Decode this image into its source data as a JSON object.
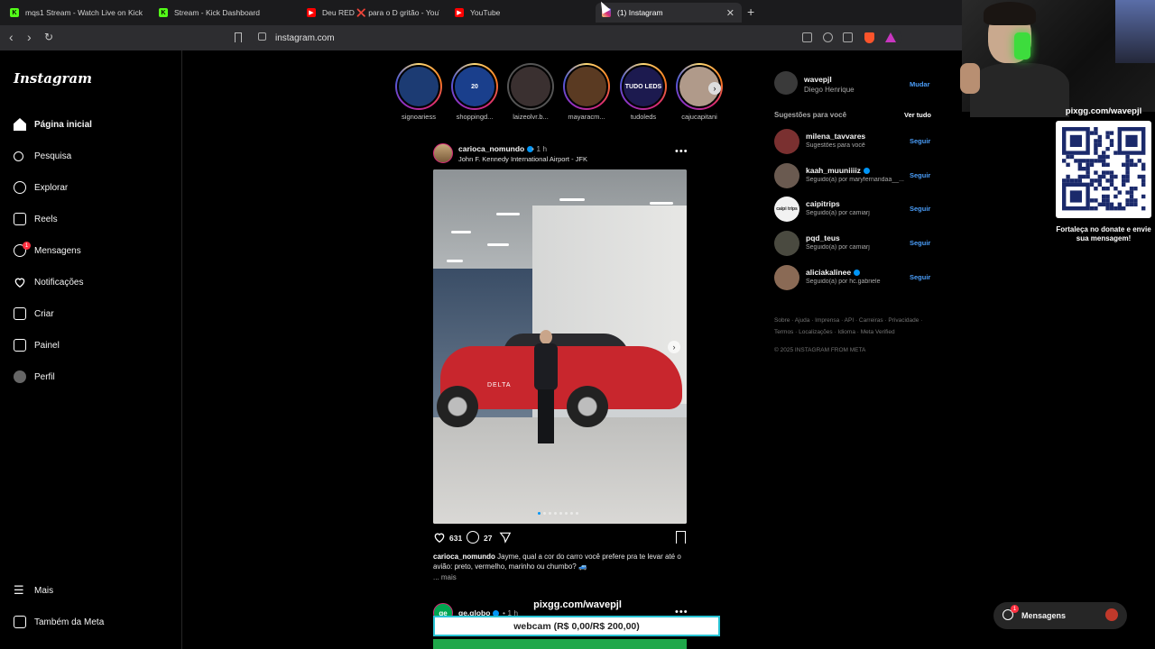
{
  "browser": {
    "tabs": [
      {
        "title": "mqs1 Stream - Watch Live on Kick",
        "icon": "kick-icon",
        "active": false
      },
      {
        "title": "Stream - Kick Dashboard",
        "icon": "kick-icon",
        "active": false
      },
      {
        "title": "Deu RED ❌ para o D gritão - YouTube",
        "icon": "youtube-icon",
        "active": false
      },
      {
        "title": "YouTube",
        "icon": "youtube-icon",
        "active": false
      },
      {
        "title": "(1) Instagram",
        "icon": "instagram-icon",
        "active": true
      }
    ],
    "url": "instagram.com"
  },
  "instagram": {
    "logo": "Instagram",
    "nav": [
      {
        "label": "Página inicial",
        "icon": "home-icon"
      },
      {
        "label": "Pesquisa",
        "icon": "search-icon"
      },
      {
        "label": "Explorar",
        "icon": "compass-icon"
      },
      {
        "label": "Reels",
        "icon": "reels-icon"
      },
      {
        "label": "Mensagens",
        "icon": "messenger-icon",
        "badge": "1"
      },
      {
        "label": "Notificações",
        "icon": "heart-icon"
      },
      {
        "label": "Criar",
        "icon": "plus-square-icon"
      },
      {
        "label": "Painel",
        "icon": "dashboard-icon"
      },
      {
        "label": "Perfil",
        "icon": "profile-avatar"
      },
      {
        "label": "Mais",
        "icon": "menu-icon"
      },
      {
        "label": "Também da Meta",
        "icon": "meta-icon"
      }
    ],
    "stories": [
      {
        "name": "signoariess",
        "color": "#1c3b73",
        "text": ""
      },
      {
        "name": "shoppingd...",
        "color": "#1a3f8c",
        "text": "20"
      },
      {
        "name": "laizeolvr.b...",
        "color": "#3a3030",
        "text": ""
      },
      {
        "name": "mayaracm...",
        "color": "#5a3a22",
        "text": ""
      },
      {
        "name": "tudoleds",
        "color": "#1c1a4f",
        "text": "TUDO LEDS"
      },
      {
        "name": "cajucapitani",
        "color": "#b09a8a",
        "text": ""
      }
    ],
    "post": {
      "user": "carioca_nomundo",
      "time": "• 1 h",
      "location": "John F. Kennedy International Airport - JFK",
      "likes": "631",
      "comments": "27",
      "caption_user": "carioca_nomundo",
      "caption": "Jayme, qual a cor do carro você prefere pra te levar até o avião: preto, vermelho, marinho ou chumbo? 🚙",
      "more": "... mais",
      "car_text": "DELTA"
    },
    "post2": {
      "avatar_text": "ge",
      "user": "ge.globo",
      "time": "• 1 h"
    },
    "profile": {
      "username": "wavepjl",
      "name": "Diego Henrique",
      "switch": "Mudar"
    },
    "suggestions_title": "Sugestões para você",
    "see_all": "Ver tudo",
    "suggestions": [
      {
        "user": "milena_tavvares",
        "sub": "Sugestões para você",
        "verified": false,
        "color": "#7a3030",
        "avatar_text": "",
        "follow": "Seguir"
      },
      {
        "user": "kaah_muuniiiiz",
        "sub": "Seguido(a) por maryfernandaa__...",
        "verified": true,
        "color": "#6a5a50",
        "avatar_text": "",
        "follow": "Seguir"
      },
      {
        "user": "caipitrips",
        "sub": "Seguido(a) por camiarj",
        "verified": false,
        "color": "#f2f2f2",
        "avatar_text": "caipi trips",
        "follow": "Seguir"
      },
      {
        "user": "pqd_teus",
        "sub": "Seguido(a) por camiarj",
        "verified": false,
        "color": "#4a4a40",
        "avatar_text": "",
        "follow": "Seguir"
      },
      {
        "user": "aliciakalinee",
        "sub": "Seguido(a) por hc.gabriele",
        "verified": true,
        "color": "#8a6a55",
        "avatar_text": "",
        "follow": "Seguir"
      }
    ],
    "footer_links": "Sobre · Ajuda · Imprensa · API · Carreiras · Privacidade · Termos · Localizações · Idioma · Meta Verified",
    "copyright": "© 2025 INSTAGRAM FROM META",
    "messages_pill": {
      "label": "Mensagens",
      "badge": "1"
    }
  },
  "overlay": {
    "pix_url_top": "pixgg.com/wavepjl",
    "qr_message": "Fortaleça no donate e envie sua mensagem!",
    "pix_url_bottom": "pixgg.com/wavepjl",
    "webcam_bar": "webcam (R$ 0,00/R$ 200,00)"
  }
}
